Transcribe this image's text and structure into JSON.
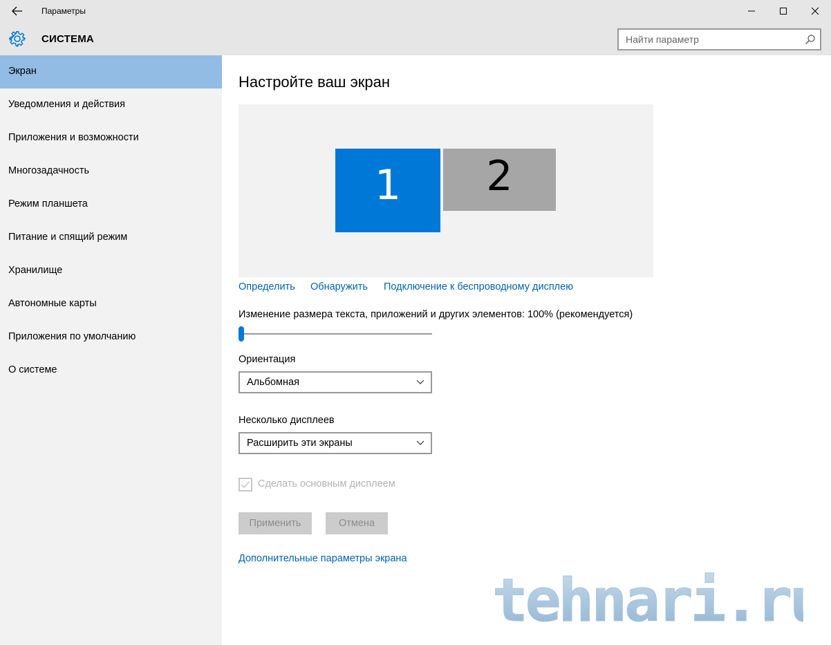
{
  "window": {
    "title": "Параметры",
    "back_icon": "arrow-left-icon",
    "controls": [
      "minimize-icon",
      "maximize-icon",
      "close-icon"
    ]
  },
  "header": {
    "section_title": "СИСТЕМА",
    "section_icon": "gear-icon",
    "search_placeholder": "Найти параметр",
    "search_value": "",
    "search_icon": "search-icon"
  },
  "sidebar": {
    "items": [
      {
        "label": "Экран",
        "selected": true
      },
      {
        "label": "Уведомления и действия"
      },
      {
        "label": "Приложения и возможности"
      },
      {
        "label": "Многозадачность"
      },
      {
        "label": "Режим планшета"
      },
      {
        "label": "Питание и спящий режим"
      },
      {
        "label": "Хранилище"
      },
      {
        "label": "Автономные карты"
      },
      {
        "label": "Приложения по умолчанию"
      },
      {
        "label": "О системе"
      }
    ]
  },
  "main": {
    "title": "Настройте ваш экран",
    "monitors": [
      {
        "number": "1",
        "selected": true
      },
      {
        "number": "2",
        "selected": false
      }
    ],
    "links": {
      "identify": "Определить",
      "detect": "Обнаружить",
      "wireless": "Подключение к беспроводному дисплею"
    },
    "scale": {
      "label": "Изменение размера текста, приложений и других элементов: 100% (рекомендуется)",
      "value_percent": 100,
      "slider_fraction": 0.0
    },
    "orientation": {
      "label": "Ориентация",
      "value": "Альбомная"
    },
    "multiple_displays": {
      "label": "Несколько дисплеев",
      "value": "Расширить эти экраны"
    },
    "primary_display": {
      "label": "Сделать основным дисплеем",
      "checked": true,
      "disabled": true
    },
    "buttons": {
      "apply": "Применить",
      "cancel": "Отмена"
    },
    "advanced_link": "Дополнительные параметры экрана"
  },
  "watermark": "tehnari.ru",
  "colors": {
    "accent": "#0078d7",
    "link": "#0063b1",
    "selected_nav": "#93bce4",
    "sidebar_bg": "#f2f2f2",
    "titlebar_bg": "#e6e6e6"
  }
}
